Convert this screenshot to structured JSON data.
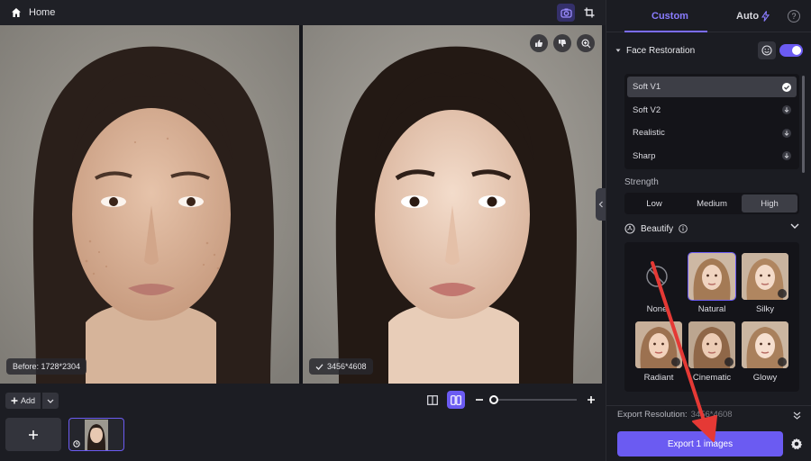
{
  "topbar": {
    "home_label": "Home",
    "home_icon": "home-icon",
    "tools": [
      "ai-camera-icon",
      "crop-icon"
    ]
  },
  "before": {
    "badge": "Before: 1728*2304"
  },
  "after": {
    "badge": "3456*4608",
    "actions": [
      "thumbs-up-icon",
      "thumbs-down-icon",
      "zoom-icon"
    ]
  },
  "bottom": {
    "add_label": "Add",
    "zoom_level": 0
  },
  "panel": {
    "tabs": {
      "custom": "Custom",
      "auto": "Auto"
    },
    "face_restoration": {
      "title": "Face Restoration",
      "enabled": true,
      "models": [
        {
          "label": "Soft V1",
          "state": "selected"
        },
        {
          "label": "Soft V2",
          "state": "download"
        },
        {
          "label": "Realistic",
          "state": "download"
        },
        {
          "label": "Sharp",
          "state": "download"
        }
      ]
    },
    "strength": {
      "label": "Strength",
      "options": [
        "Low",
        "Medium",
        "High"
      ],
      "selected": "High"
    },
    "beautify": {
      "title": "Beautify",
      "presets": [
        "None",
        "Natural",
        "Silky",
        "Radiant",
        "Cinematic",
        "Glowy"
      ],
      "selected": "Natural"
    },
    "export": {
      "label": "Export Resolution:",
      "value": "3456*4608",
      "button": "Export 1 images"
    }
  },
  "colors": {
    "accent": "#6b5bf2",
    "accent_text": "#8a7cff",
    "annotation_arrow": "#e53935"
  }
}
